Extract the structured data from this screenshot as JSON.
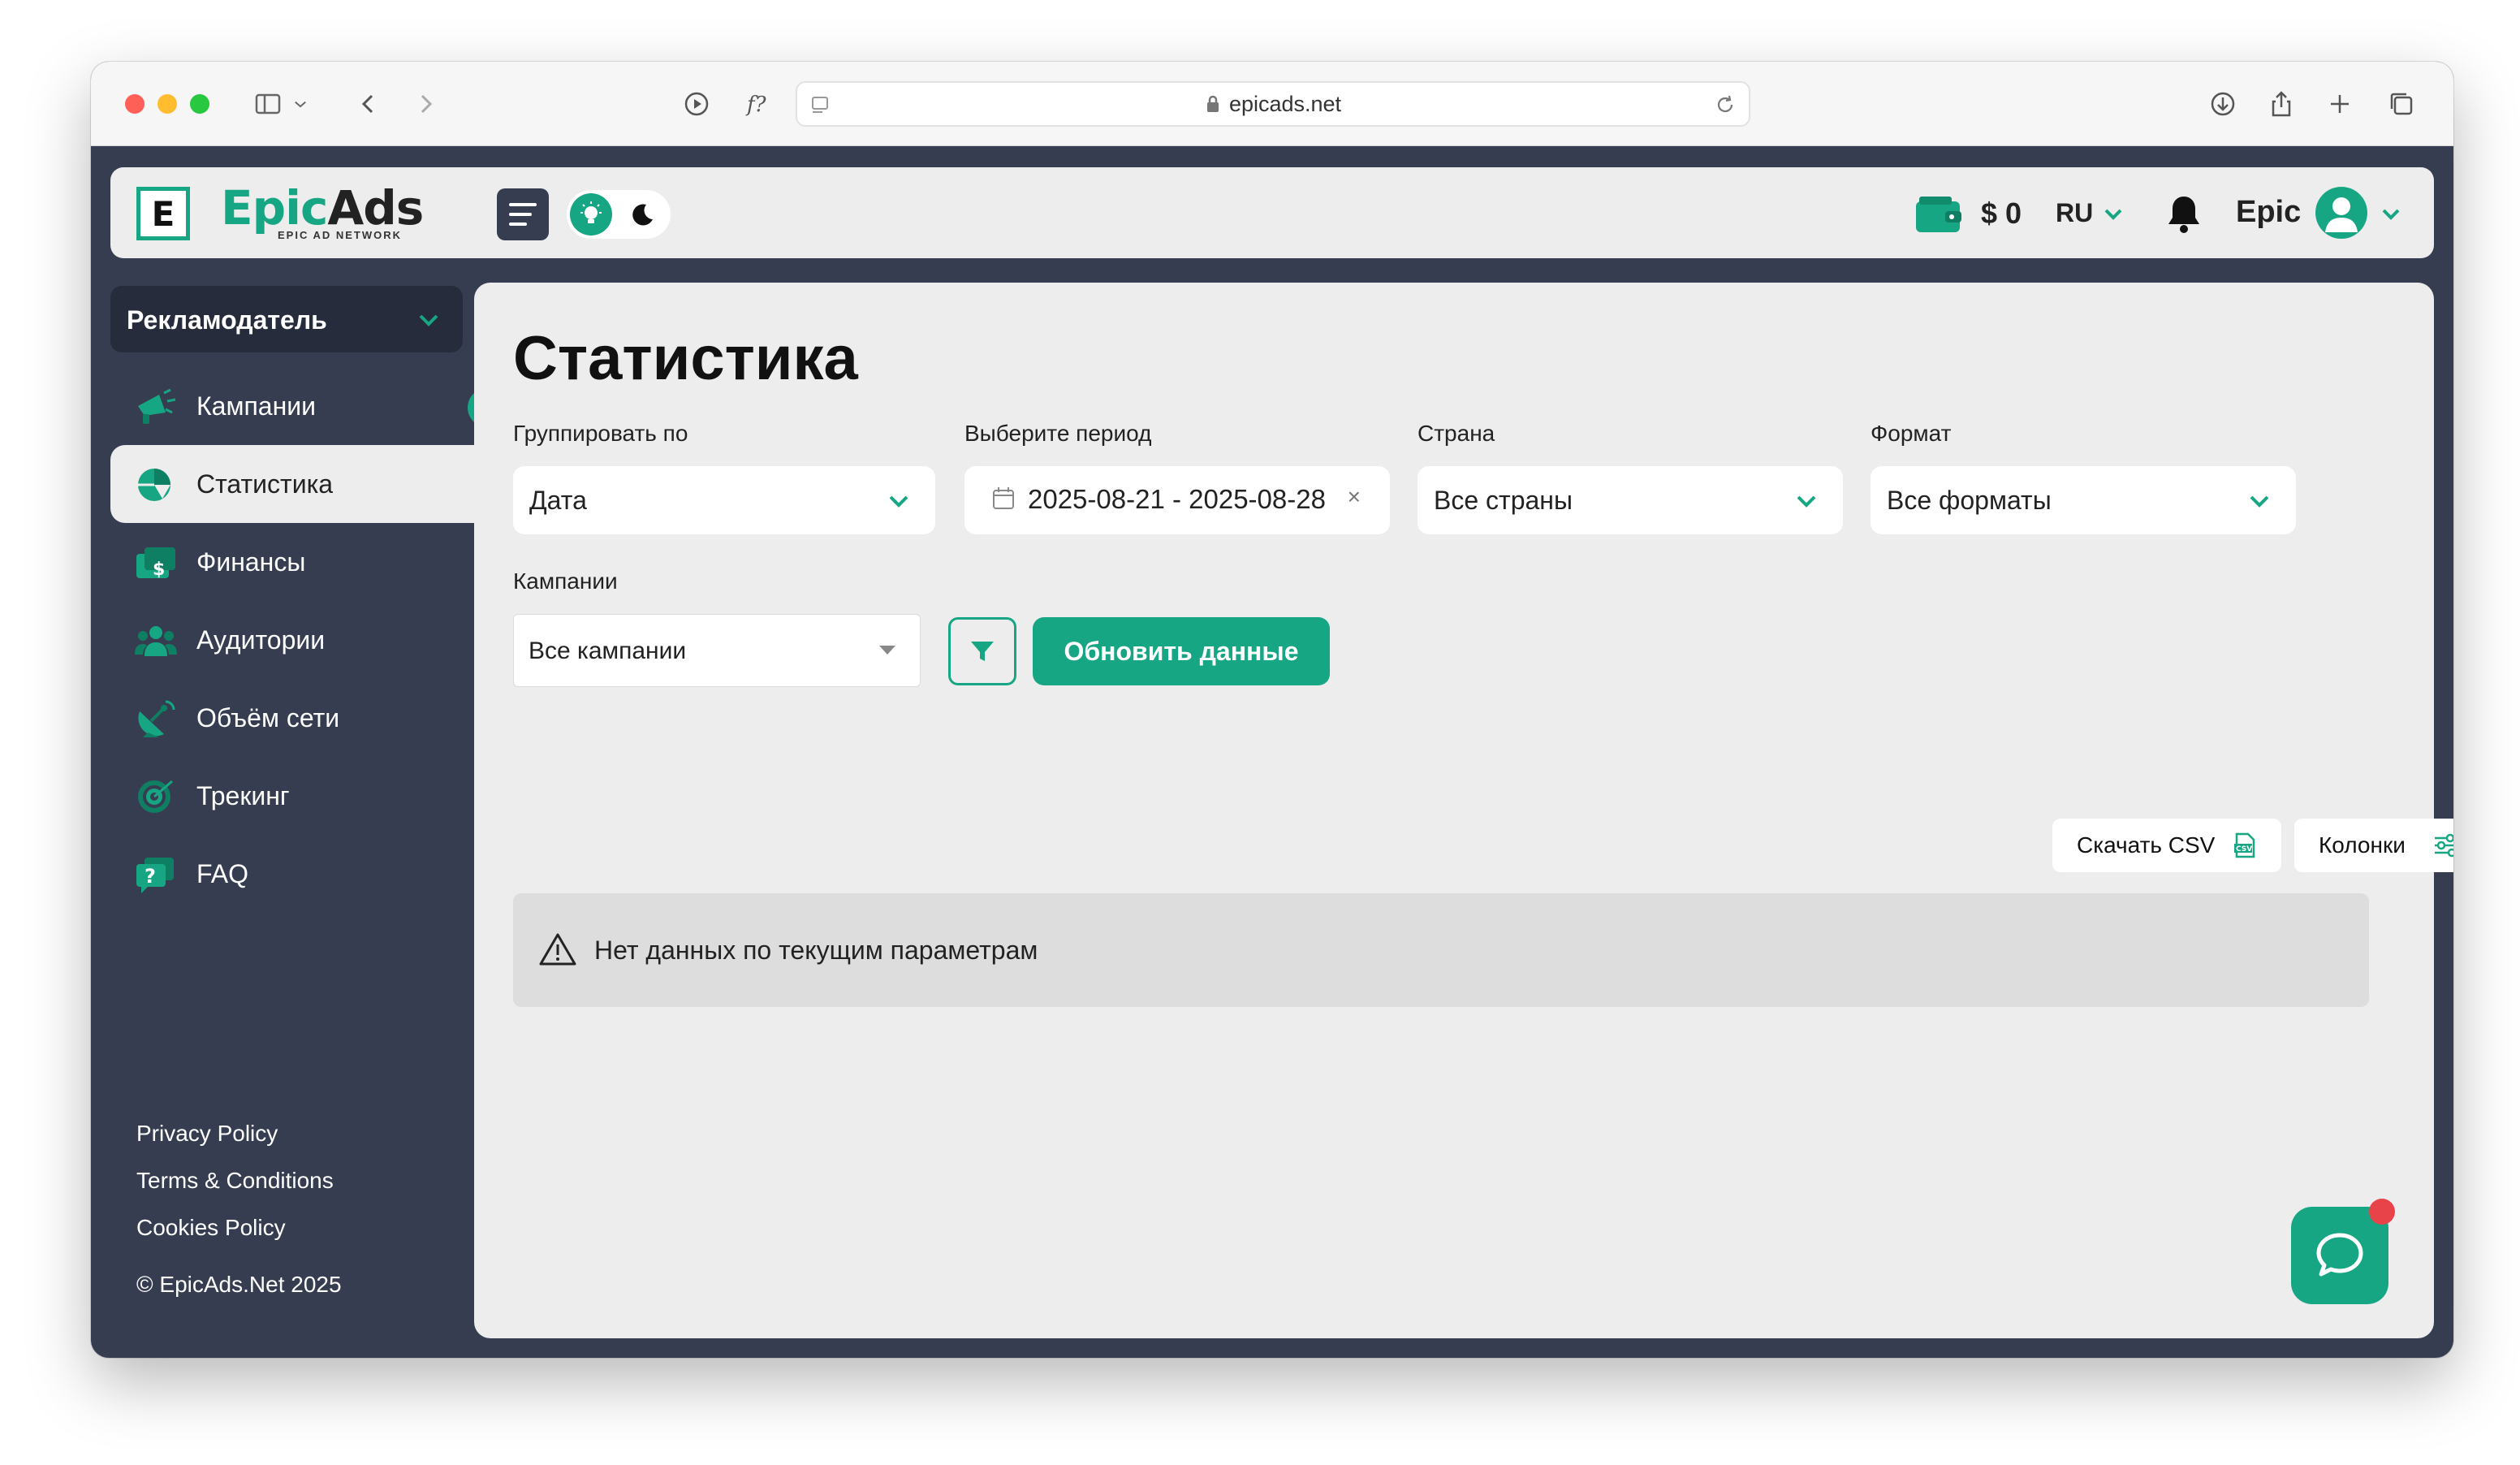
{
  "browser": {
    "url": "epicads.net"
  },
  "header": {
    "logo_letter": "E",
    "logo_part1": "Epic",
    "logo_part2": "Ads",
    "logo_tagline": "EPIC AD NETWORK",
    "balance": "$ 0",
    "language": "RU",
    "username": "Epic"
  },
  "sidebar": {
    "role": "Рекламодатель",
    "items": [
      {
        "label": "Кампании",
        "icon": "megaphone-icon"
      },
      {
        "label": "Статистика",
        "icon": "pie-chart-icon",
        "active": true
      },
      {
        "label": "Финансы",
        "icon": "money-icon"
      },
      {
        "label": "Аудитории",
        "icon": "users-icon"
      },
      {
        "label": "Объём сети",
        "icon": "satellite-icon"
      },
      {
        "label": "Трекинг",
        "icon": "target-icon"
      },
      {
        "label": "FAQ",
        "icon": "faq-icon"
      }
    ],
    "footer_links": [
      "Privacy Policy",
      "Terms & Conditions",
      "Cookies Policy"
    ],
    "copyright": "© EpicAds.Net 2025"
  },
  "main": {
    "title": "Статистика",
    "filters": {
      "group_by": {
        "label": "Группировать по",
        "value": "Дата"
      },
      "period": {
        "label": "Выберите период",
        "value": "2025-08-21 - 2025-08-28",
        "clear": "×"
      },
      "country": {
        "label": "Страна",
        "value": "Все страны"
      },
      "format": {
        "label": "Формат",
        "value": "Все форматы"
      },
      "campaigns": {
        "label": "Кампании",
        "value": "Все кампании"
      }
    },
    "refresh_button": "Обновить данные",
    "download_csv": "Скачать CSV",
    "columns_button": "Колонки",
    "empty_message": "Нет данных по текущим параметрам"
  },
  "colors": {
    "accent": "#17a683",
    "sidebar_bg": "#363d51",
    "panel_bg": "#ededed",
    "notification": "#e9434a"
  }
}
